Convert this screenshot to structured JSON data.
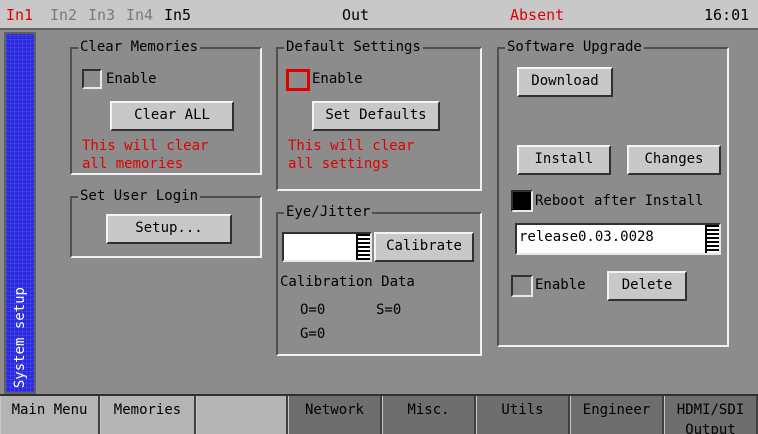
{
  "topbar": {
    "inputs": [
      "In1",
      "In2",
      "In3",
      "In4",
      "In5"
    ],
    "out": "Out",
    "status": "Absent",
    "time": "16:01"
  },
  "sidebar": {
    "label": "System setup"
  },
  "clear_memories": {
    "title": "Clear Memories",
    "enable_label": "Enable",
    "button": "Clear ALL",
    "warning_line1": "This will clear",
    "warning_line2": "all memories"
  },
  "set_user_login": {
    "title": "Set User Login",
    "button": "Setup..."
  },
  "default_settings": {
    "title": "Default Settings",
    "enable_label": "Enable",
    "button": "Set Defaults",
    "warning_line1": "This will clear",
    "warning_line2": "all settings"
  },
  "eye_jitter": {
    "title": "Eye/Jitter",
    "value": "",
    "button": "Calibrate",
    "data_label": "Calibration Data",
    "o_value": "O=0",
    "s_value": "S=0",
    "g_value": "G=0"
  },
  "software_upgrade": {
    "title": "Software Upgrade",
    "download": "Download",
    "install": "Install",
    "changes": "Changes",
    "reboot_label": "Reboot after Install",
    "release": "release0.03.0028",
    "enable_label": "Enable",
    "delete": "Delete"
  },
  "bottom_tabs": [
    "Main Menu",
    "Memories",
    "",
    "Network",
    "Misc.",
    "Utils",
    "Engineer",
    "HDMI/SDI Output"
  ],
  "colors": {
    "accent_red": "#e00000",
    "sidebar_blue": "#2a2ae0",
    "panel_grey": "#8c8c8c"
  }
}
